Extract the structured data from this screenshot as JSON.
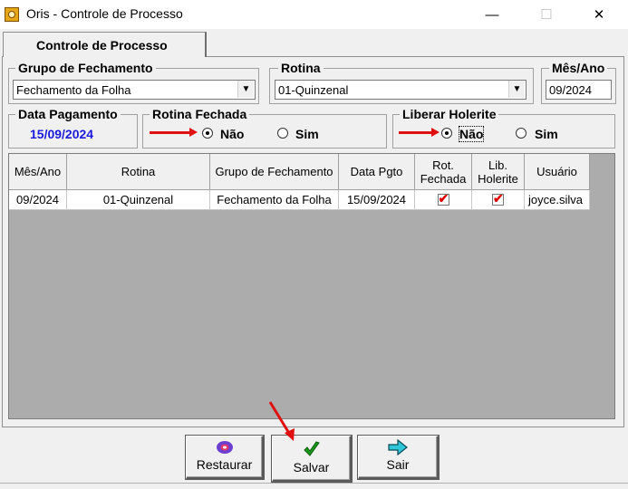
{
  "window": {
    "title": "Oris - Controle de Processo",
    "minimize": "—",
    "maximize": "☐",
    "close": "✕"
  },
  "tab": {
    "label": "Controle de  Processo"
  },
  "grupo": {
    "title": "Grupo de Fechamento",
    "value": "Fechamento da Folha",
    "dropdown_icon": "▼"
  },
  "rotina": {
    "title": "Rotina",
    "value": "01-Quinzenal",
    "dropdown_icon": "▼"
  },
  "mesano": {
    "title": "Mês/Ano",
    "value": "09/2024"
  },
  "data_pagamento": {
    "title": "Data Pagamento",
    "value": "15/09/2024"
  },
  "rotina_fechada": {
    "title": "Rotina Fechada",
    "opt_nao": "Não",
    "opt_sim": "Sim",
    "selected": "Não"
  },
  "liberar_holerite": {
    "title": "Liberar Holerite",
    "opt_nao": "Não",
    "opt_sim": "Sim",
    "selected": "Não"
  },
  "table": {
    "headers": [
      "Mês/Ano",
      "Rotina",
      "Grupo de Fechamento",
      "Data Pgto",
      "Rot.\nFechada",
      "Lib.\nHolerite",
      "Usuário"
    ],
    "rows": [
      {
        "mesano": "09/2024",
        "rotina": "01-Quinzenal",
        "grupo": "Fechamento da Folha",
        "data": "15/09/2024",
        "rot_fechada": "✔",
        "lib_holerite": "✔",
        "usuario": "joyce.silva"
      }
    ]
  },
  "buttons": {
    "restaurar": {
      "label": "Restaurar",
      "icon": "restore-icon"
    },
    "salvar": {
      "label": "Salvar",
      "icon": "checkmark-icon"
    },
    "sair": {
      "label": "Sair",
      "icon": "arrow-right-icon"
    }
  },
  "colors": {
    "date_value": "#1a1adc",
    "annotation_arrow": "#e01010",
    "check_mark": "#e00000"
  }
}
